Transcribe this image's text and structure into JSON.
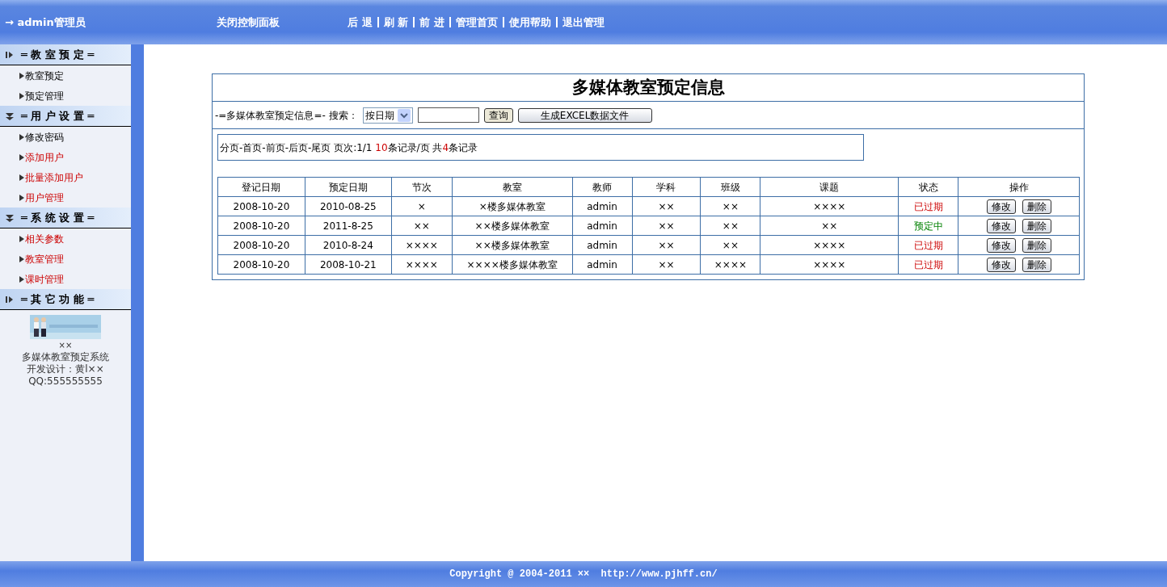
{
  "topbar": {
    "user": "→ admin管理员",
    "close_panel": "关闭控制面板",
    "nav": [
      "后 退",
      "刷 新",
      "前 进",
      "管理首页",
      "使用帮助",
      "退出管理"
    ]
  },
  "sidebar": {
    "sections": [
      {
        "title": "═ 教 室 预 定 ═",
        "expanded": false,
        "items": [
          {
            "label": "教室预定",
            "highlighted": false
          },
          {
            "label": "预定管理",
            "highlighted": false
          }
        ]
      },
      {
        "title": "═ 用 户 设 置 ═",
        "expanded": true,
        "items": [
          {
            "label": "修改密码",
            "highlighted": false
          },
          {
            "label": "添加用户",
            "highlighted": true
          },
          {
            "label": "批量添加用户",
            "highlighted": true
          },
          {
            "label": "用户管理",
            "highlighted": true
          }
        ]
      },
      {
        "title": "═ 系 统 设 置 ═",
        "expanded": true,
        "items": [
          {
            "label": "相关参数",
            "highlighted": true
          },
          {
            "label": "教室管理",
            "highlighted": true
          },
          {
            "label": "课时管理",
            "highlighted": true
          }
        ]
      },
      {
        "title": "═ 其 它 功 能 ═",
        "expanded": false
      }
    ],
    "info": {
      "lines": [
        "××",
        "多媒体教室预定系统",
        "开发设计：黄l××",
        "QQ:555555555"
      ]
    }
  },
  "main": {
    "title": "多媒体教室预定信息",
    "search": {
      "label": "-=多媒体教室预定信息=- 搜索：",
      "select": "按日期",
      "query_button": "查询",
      "excel_button": "生成EXCEL数据文件"
    },
    "pager": {
      "links": "分页-首页-前页-后页-尾页",
      "page": "页次:1/1",
      "per_page": "10",
      "per_page_suffix": "条记录/页",
      "total_prefix": "共",
      "total": "4",
      "total_suffix": "条记录"
    },
    "table": {
      "columns": [
        "登记日期",
        "预定日期",
        "节次",
        "教室",
        "教师",
        "学科",
        "班级",
        "课题",
        "状态",
        "操作"
      ],
      "rows": [
        {
          "cells": [
            "2008-10-20",
            "2010-08-25",
            "×",
            "×楼多媒体教室",
            "admin",
            "××",
            "××",
            "××××"
          ],
          "status": "已过期",
          "kind": "expired",
          "actions": [
            "修改",
            "删除"
          ]
        },
        {
          "cells": [
            "2008-10-20",
            "2011-8-25",
            "××",
            "××楼多媒体教室",
            "admin",
            "××",
            "××",
            "××"
          ],
          "status": "预定中",
          "kind": "booked",
          "actions": [
            "修改",
            "删除"
          ]
        },
        {
          "cells": [
            "2008-10-20",
            "2010-8-24",
            "××××",
            "××楼多媒体教室",
            "admin",
            "××",
            "××",
            "××××"
          ],
          "status": "已过期",
          "kind": "expired",
          "actions": [
            "修改",
            "删除"
          ]
        },
        {
          "cells": [
            "2008-10-20",
            "2008-10-21",
            "××××",
            "××××楼多媒体教室",
            "admin",
            "××",
            "××××",
            "××××"
          ],
          "status": "已过期",
          "kind": "expired",
          "actions": [
            "修改",
            "删除"
          ]
        }
      ]
    }
  },
  "footer": "Copyright @ 2004-2011 ××  http://www.pjhff.cn/"
}
